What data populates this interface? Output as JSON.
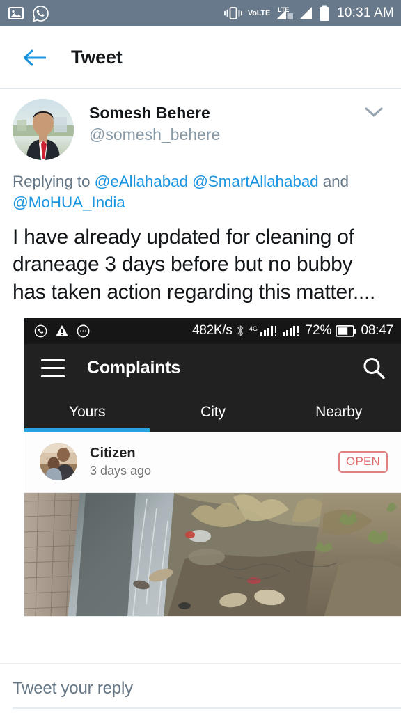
{
  "system_status_bar": {
    "left_icons": [
      "image-icon",
      "whatsapp-icon"
    ],
    "vibrate_icon": "vibrate-icon",
    "volte_label": "VoLTE",
    "lte_label": "LTE",
    "signal_icons": [
      "signal-bars-1-icon",
      "signal-bars-2-icon"
    ],
    "battery_icon": "battery-icon",
    "time": "10:31 AM",
    "background_color": "#67798a"
  },
  "app_bar": {
    "back_icon": "back-arrow-icon",
    "title": "Tweet",
    "accent_color": "#1b95e0"
  },
  "tweet": {
    "avatar_name": "avatar",
    "full_name": "Somesh Behere",
    "handle": "@somesh_behere",
    "caret_icon": "chevron-down-icon",
    "replying_prefix": "Replying to ",
    "replying_mentions": [
      "@eAllahabad",
      "@SmartAllahabad",
      "@MoHUA_India"
    ],
    "replying_conjunction": " and ",
    "body": "I have already updated for cleaning of draneage 3 days before but no bubby has taken action regarding this matter....",
    "mention_color": "#1b95e0",
    "meta_color": "#657786"
  },
  "embedded_screenshot": {
    "status_bar": {
      "left_icons": [
        "whatsapp-icon",
        "warning-triangle-icon",
        "message-dots-icon"
      ],
      "net_speed": "482K/s",
      "bluetooth_icon": "bluetooth-icon",
      "network_label": "4G",
      "signal_icons": [
        "signal-bars-4g-icon",
        "signal-bars-2-icon"
      ],
      "battery_percent": "72%",
      "battery_icon": "battery-icon",
      "time": "08:47",
      "background_color": "#161616"
    },
    "app_bar": {
      "menu_icon": "hamburger-menu-icon",
      "title": "Complaints",
      "search_icon": "search-icon",
      "background_color": "#212121"
    },
    "tabs": {
      "items": [
        {
          "label": "Yours",
          "active": true
        },
        {
          "label": "City",
          "active": false
        },
        {
          "label": "Nearby",
          "active": false
        }
      ],
      "indicator_color": "#29a3e0"
    },
    "complaint": {
      "avatar_name": "citizen-avatar",
      "author": "Citizen",
      "timestamp": "3 days ago",
      "status_badge": "OPEN",
      "status_color": "#e06a6a",
      "photo_alt": "clogged-drain-photo"
    }
  },
  "reply": {
    "placeholder": "Tweet your reply"
  }
}
